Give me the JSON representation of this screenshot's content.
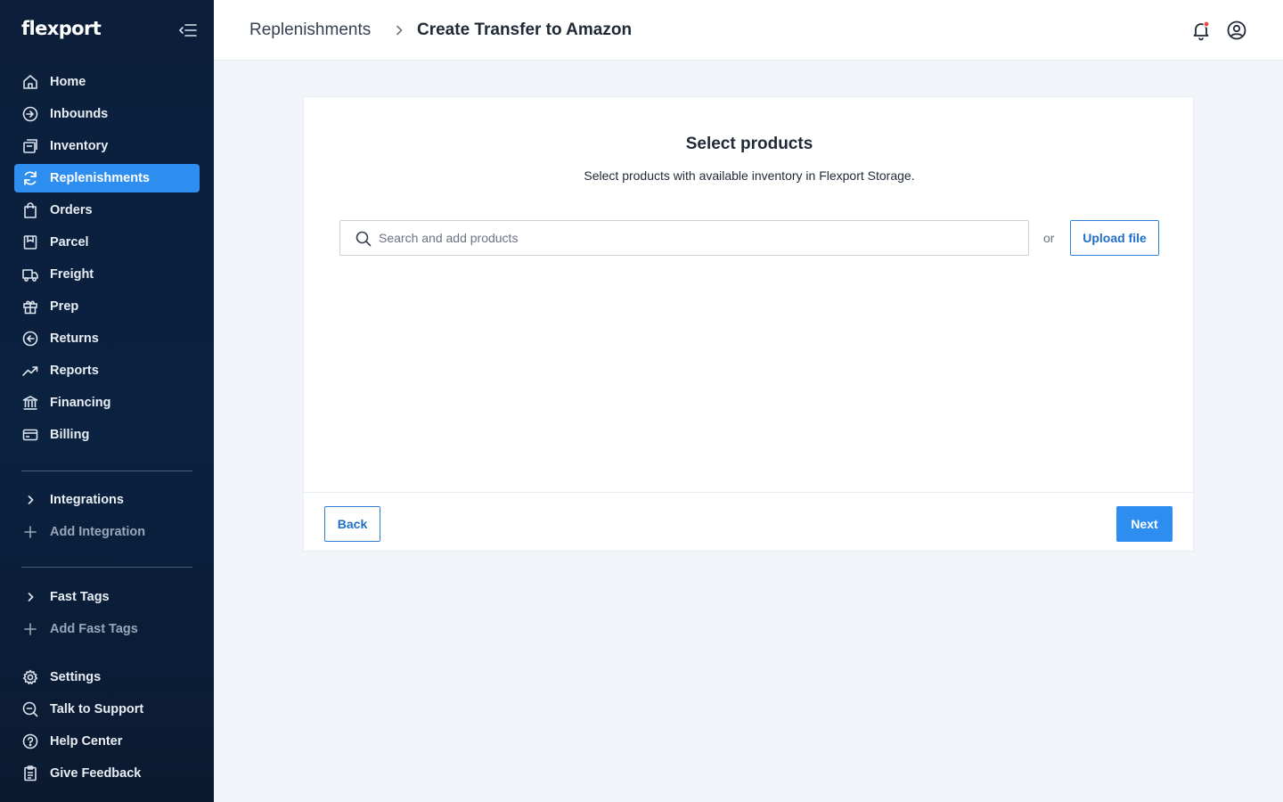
{
  "brand": {
    "name": "flexport"
  },
  "colors": {
    "sidebar_bg": "#0b1f3a",
    "accent": "#2d8ef0",
    "notification_dot": "#ef4444"
  },
  "sidebar": {
    "items": [
      {
        "label": "Home",
        "icon": "home-icon"
      },
      {
        "label": "Inbounds",
        "icon": "inbounds-icon"
      },
      {
        "label": "Inventory",
        "icon": "inventory-icon"
      },
      {
        "label": "Replenishments",
        "icon": "replenishments-icon",
        "active": true
      },
      {
        "label": "Orders",
        "icon": "orders-bag-icon"
      },
      {
        "label": "Parcel",
        "icon": "parcel-icon"
      },
      {
        "label": "Freight",
        "icon": "truck-icon"
      },
      {
        "label": "Prep",
        "icon": "gift-icon"
      },
      {
        "label": "Returns",
        "icon": "returns-icon"
      },
      {
        "label": "Reports",
        "icon": "trend-icon"
      },
      {
        "label": "Financing",
        "icon": "bank-icon"
      },
      {
        "label": "Billing",
        "icon": "card-icon"
      }
    ],
    "integrations": {
      "label": "Integrations",
      "add_label": "Add Integration"
    },
    "fast_tags": {
      "label": "Fast Tags",
      "add_label": "Add Fast Tags"
    },
    "bottom": [
      {
        "label": "Settings",
        "icon": "gear-icon"
      },
      {
        "label": "Talk to Support",
        "icon": "support-chat-icon"
      },
      {
        "label": "Help Center",
        "icon": "help-icon"
      },
      {
        "label": "Give Feedback",
        "icon": "clipboard-icon"
      }
    ]
  },
  "header": {
    "breadcrumb_root": "Replenishments",
    "breadcrumb_current": "Create Transfer to Amazon"
  },
  "main": {
    "title": "Select products",
    "subtitle": "Select products with available inventory in Flexport Storage.",
    "search": {
      "placeholder": "Search and add products",
      "value": ""
    },
    "or_label": "or",
    "upload_label": "Upload file",
    "back_label": "Back",
    "next_label": "Next"
  }
}
